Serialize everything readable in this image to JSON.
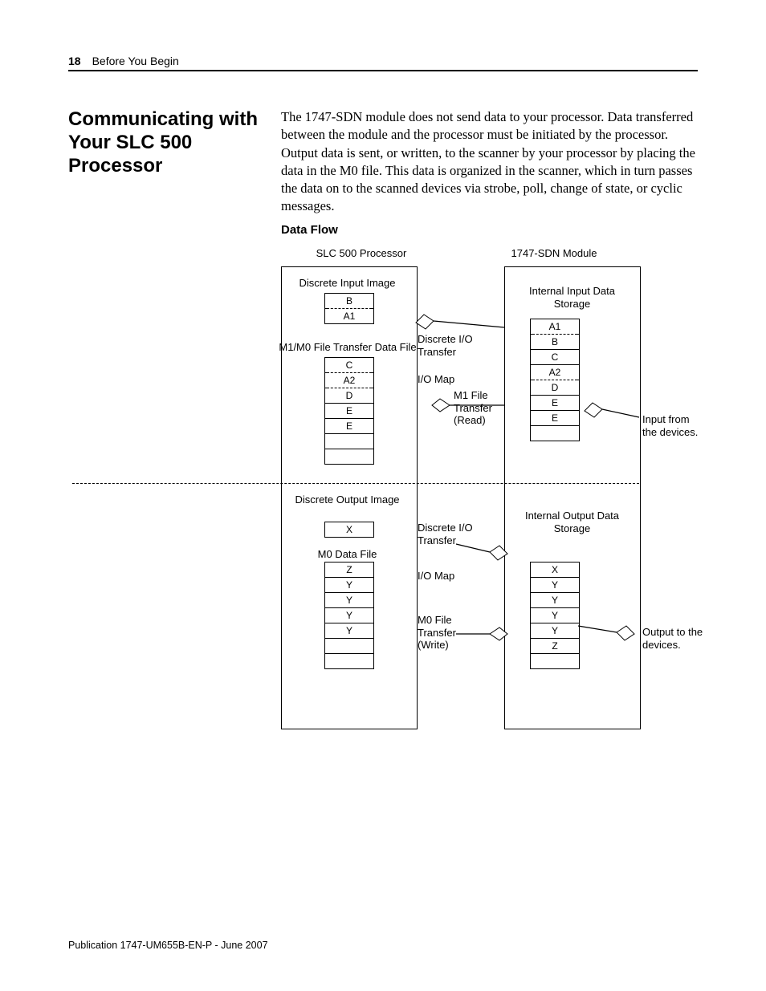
{
  "header": {
    "pageNum": "18",
    "chapter": "Before You Begin"
  },
  "heading": "Communicating with Your SLC 500 Processor",
  "body": "The 1747-SDN module does not send data to your processor. Data transferred between the module and the processor must be initiated by the processor. Output data is sent, or written, to the scanner by your processor by placing the data in the M0 file. This data is organized in the scanner, which in turn passes the data on to the scanned devices via strobe, poll, change of state, or cyclic messages.",
  "subheading": "Data Flow",
  "diagram": {
    "colLeft": "SLC 500 Processor",
    "colRight": "1747-SDN Module",
    "discreteInput": "Discrete Input Image",
    "inputImageRows": [
      "B",
      "A1"
    ],
    "m1m0": "M1/M0 File Transfer Data File",
    "m1m0Rows": [
      "C",
      "A2",
      "D",
      "E",
      "E",
      "",
      ""
    ],
    "discreteOutput": "Discrete Output Image",
    "outputImageRows": [
      "X"
    ],
    "m0Data": "M0 Data File",
    "m0Rows": [
      "Z",
      "Y",
      "Y",
      "Y",
      "Y",
      "",
      ""
    ],
    "internalInput": "Internal Input Data Storage",
    "internalInputRows": [
      "A1",
      "B",
      "C",
      "A2",
      "D",
      "E",
      "E",
      ""
    ],
    "internalOutput": "Internal Output Data Storage",
    "internalOutputRows": [
      "X",
      "Y",
      "Y",
      "Y",
      "Y",
      "Z",
      ""
    ],
    "dioTransfer": "Discrete I/O Transfer",
    "ioMap": "I/O Map",
    "m1Read": "M1 File Transfer (Read)",
    "m0Write": "M0 File Transfer (Write)",
    "inputFrom": "Input from the devices.",
    "outputTo": "Output to the devices."
  },
  "footer": "Publication 1747-UM655B-EN-P - June 2007"
}
